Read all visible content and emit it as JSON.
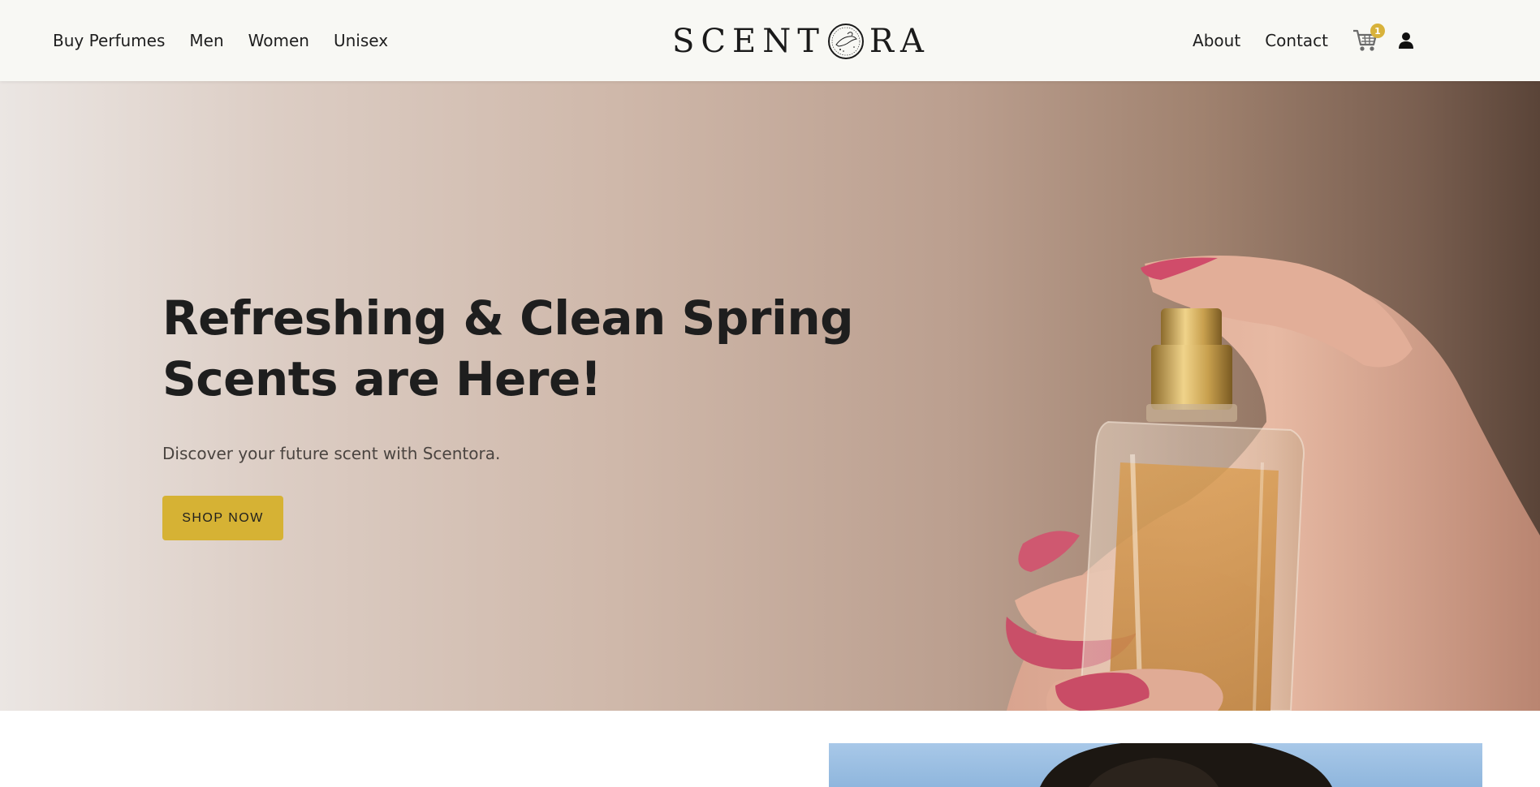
{
  "nav": {
    "left": [
      {
        "label": "Buy Perfumes"
      },
      {
        "label": "Men"
      },
      {
        "label": "Women"
      },
      {
        "label": "Unisex"
      }
    ],
    "right": [
      {
        "label": "About"
      },
      {
        "label": "Contact"
      }
    ],
    "cart_count": "1",
    "cart_icon": "cart-icon",
    "user_icon": "user-icon"
  },
  "logo": {
    "left_text": "SCENT",
    "right_text": "RA"
  },
  "hero": {
    "title_line1": "Refreshing & Clean Spring",
    "title_line2": "Scents are Here!",
    "subtitle": "Discover your future scent with Scentora.",
    "cta_label": "SHOP NOW"
  },
  "colors": {
    "accent": "#d6b234",
    "header_bg": "#f8f8f4",
    "text": "#1e1e1e"
  }
}
